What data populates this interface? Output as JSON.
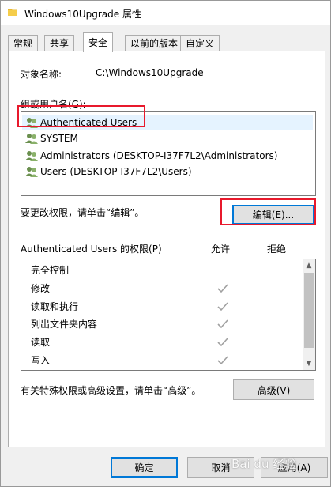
{
  "window": {
    "title": "Windows10Upgrade 属性"
  },
  "tabs": [
    {
      "label": "常规"
    },
    {
      "label": "共享"
    },
    {
      "label": "安全"
    },
    {
      "label": "以前的版本"
    },
    {
      "label": "自定义"
    }
  ],
  "security": {
    "object_name_label": "对象名称:",
    "object_name_value": "C:\\Windows10Upgrade",
    "group_label": "组或用户名(G):",
    "users": [
      {
        "name": "Authenticated Users"
      },
      {
        "name": "SYSTEM"
      },
      {
        "name": "Administrators (DESKTOP-I37F7L2\\Administrators)"
      },
      {
        "name": "Users (DESKTOP-I37F7L2\\Users)"
      }
    ],
    "edit_hint": "要更改权限，请单击“编辑”。",
    "edit_button": "编辑(E)...",
    "perm_header": "Authenticated Users 的权限(P)",
    "allow_col": "允许",
    "deny_col": "拒绝",
    "permissions": [
      {
        "name": "完全控制",
        "allow": false
      },
      {
        "name": "修改",
        "allow": true
      },
      {
        "name": "读取和执行",
        "allow": true
      },
      {
        "name": "列出文件夹内容",
        "allow": true
      },
      {
        "name": "读取",
        "allow": true
      },
      {
        "name": "写入",
        "allow": true
      }
    ],
    "advanced_hint": "有关特殊权限或高级设置，请单击“高级”。",
    "advanced_button": "高级(V)"
  },
  "footer": {
    "ok_button": "确定",
    "cancel_button": "取消",
    "apply_button": "应用(A)"
  },
  "watermark": "Bai du 经验",
  "colors": {
    "highlight_box": "#e8192c",
    "selection": "#e5f3ff",
    "check": "#a0a0a0"
  }
}
